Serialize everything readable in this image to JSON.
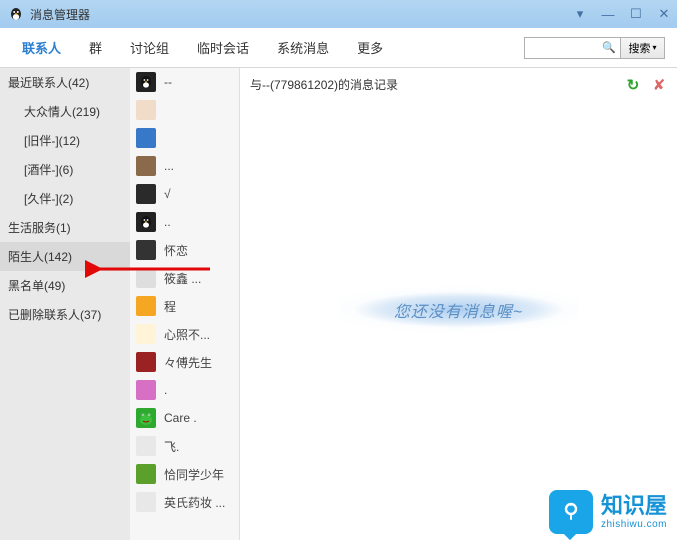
{
  "titlebar": {
    "title": "消息管理器"
  },
  "tabs": [
    {
      "label": "联系人",
      "active": true
    },
    {
      "label": "群"
    },
    {
      "label": "讨论组"
    },
    {
      "label": "临时会话"
    },
    {
      "label": "系统消息"
    },
    {
      "label": "更多"
    }
  ],
  "search": {
    "placeholder": "",
    "button": "搜索"
  },
  "categories": [
    {
      "label": "最近联系人(42)",
      "sub": false
    },
    {
      "label": "大众情人(219)",
      "sub": true
    },
    {
      "label": "[旧伴-](12)",
      "sub": true
    },
    {
      "label": "[酒伴-](6)",
      "sub": true
    },
    {
      "label": "[久伴-](2)",
      "sub": true
    },
    {
      "label": "生活服务(1)",
      "sub": false
    },
    {
      "label": "陌生人(142)",
      "sub": false,
      "selected": true
    },
    {
      "label": "黑名单(49)",
      "sub": false
    },
    {
      "label": "已删除联系人(37)",
      "sub": false
    }
  ],
  "contacts": [
    {
      "name": "--",
      "avatar_bg": "#222",
      "avatar_type": "penguin"
    },
    {
      "name": "",
      "avatar_bg": "#f0dcc8"
    },
    {
      "name": "",
      "avatar_bg": "#3878c8"
    },
    {
      "name": "...",
      "avatar_bg": "#8a6a4a"
    },
    {
      "name": "√",
      "avatar_bg": "#2a2a2a"
    },
    {
      "name": "..",
      "avatar_bg": "#222",
      "avatar_type": "penguin"
    },
    {
      "name": "怀恋",
      "avatar_bg": "#333"
    },
    {
      "name": "筱鑫 ...",
      "avatar_bg": "#dedede"
    },
    {
      "name": "程",
      "avatar_bg": "#f5a623"
    },
    {
      "name": "心照不...",
      "avatar_bg": "#fff4d8"
    },
    {
      "name": "々傅先生",
      "avatar_bg": "#9b2222"
    },
    {
      "name": ".",
      "avatar_bg": "#d770c4"
    },
    {
      "name": "Care .",
      "avatar_bg": "#2fa82f",
      "avatar_type": "frog"
    },
    {
      "name": "飞.",
      "avatar_bg": "#e8e8e8"
    },
    {
      "name": "恰同学少年",
      "avatar_bg": "#5aa02a"
    },
    {
      "name": "英氏药妆 ...",
      "avatar_bg": "#e8e8e8"
    }
  ],
  "chat": {
    "header": "与--(779861202)的消息记录",
    "empty": "您还没有消息喔~"
  },
  "watermark": {
    "cn": "知识屋",
    "py": "zhishiwu.com"
  }
}
